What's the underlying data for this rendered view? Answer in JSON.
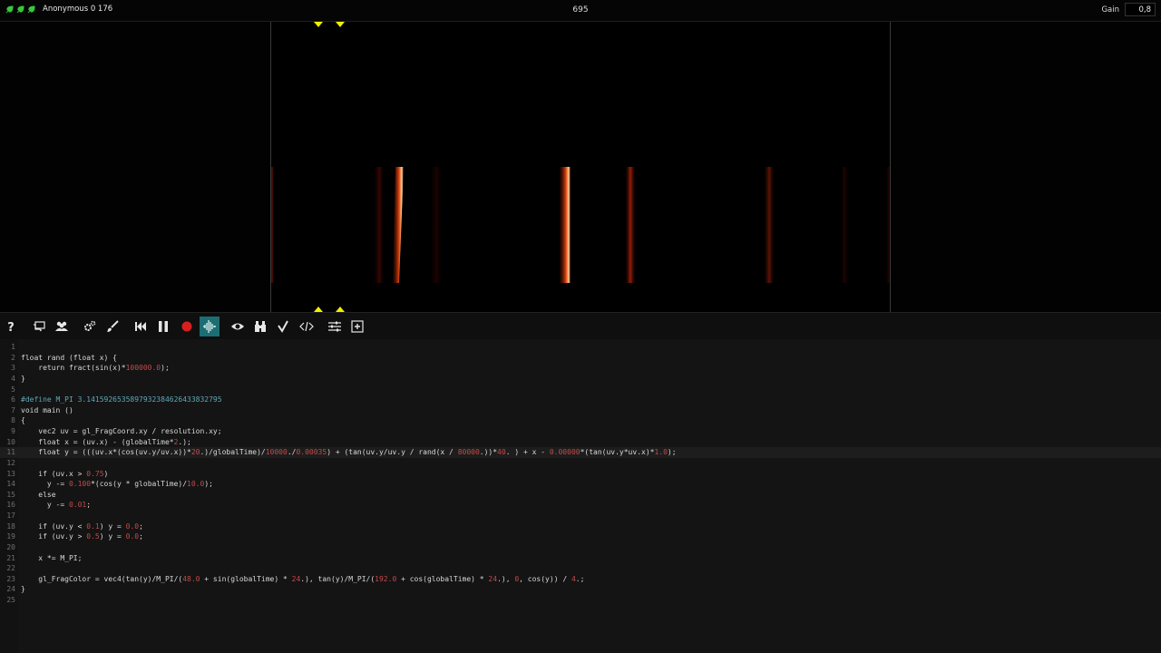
{
  "header": {
    "user_label": "Anonymous 0 176",
    "frame_counter": "695",
    "gain_label": "Gain",
    "gain_value": "0,8"
  },
  "toolbar": {
    "buttons": [
      {
        "name": "help-icon"
      },
      {
        "name": "chat-icon"
      },
      {
        "name": "users-icon"
      },
      {
        "name": "settings-icon"
      },
      {
        "name": "brush-icon"
      },
      {
        "name": "rewind-icon"
      },
      {
        "name": "pause-icon"
      },
      {
        "name": "record-icon"
      },
      {
        "name": "waveform-icon",
        "active": true
      },
      {
        "name": "eye-icon"
      },
      {
        "name": "binoculars-icon"
      },
      {
        "name": "check-icon"
      },
      {
        "name": "code-icon"
      },
      {
        "name": "sliders-icon"
      },
      {
        "name": "add-icon"
      }
    ]
  },
  "colors": {
    "accent": "#1b6e73",
    "marker": "#f0f000",
    "record": "#d62020"
  },
  "editor": {
    "active_line": 11,
    "lines": [
      {
        "n": "1",
        "t": ""
      },
      {
        "n": "2",
        "t": "float rand (float x) {"
      },
      {
        "n": "3",
        "t": "    return fract(sin(x)*100000.0);"
      },
      {
        "n": "4",
        "t": "}"
      },
      {
        "n": "5",
        "t": ""
      },
      {
        "n": "6",
        "t": "#define M_PI 3.1415926535897932384626433832795"
      },
      {
        "n": "7",
        "t": "void main ()"
      },
      {
        "n": "8",
        "t": "{"
      },
      {
        "n": "9",
        "t": "    vec2 uv = gl_FragCoord.xy / resolution.xy;"
      },
      {
        "n": "10",
        "t": "    float x = (uv.x) - (globalTime*2.);"
      },
      {
        "n": "11",
        "t": "    float y = (((uv.x*(cos(uv.y/uv.x))*20.)/globalTime)/10000./0.00035) + (tan(uv.y/uv.y / rand(x / 80000.))*40. ) + x - 0.00000*(tan(uv.y*uv.x)*1.0);"
      },
      {
        "n": "12",
        "t": ""
      },
      {
        "n": "13",
        "t": "    if (uv.x > 0.75)"
      },
      {
        "n": "14",
        "t": "      y -= 0.100*(cos(y * globalTime)/10.0);"
      },
      {
        "n": "15",
        "t": "    else"
      },
      {
        "n": "16",
        "t": "      y -= 0.01;"
      },
      {
        "n": "17",
        "t": ""
      },
      {
        "n": "18",
        "t": "    if (uv.y < 0.1) y = 0.0;"
      },
      {
        "n": "19",
        "t": "    if (uv.y > 0.5) y = 0.0;"
      },
      {
        "n": "20",
        "t": ""
      },
      {
        "n": "21",
        "t": "    x *= M_PI;"
      },
      {
        "n": "22",
        "t": ""
      },
      {
        "n": "23",
        "t": "    gl_FragColor = vec4(tan(y)/M_PI/(48.0 + sin(globalTime) * 24.), tan(y)/M_PI/(192.0 + cos(globalTime) * 24.), 0, cos(y)) / 4.;"
      },
      {
        "n": "24",
        "t": "}"
      },
      {
        "n": "25",
        "t": ""
      }
    ]
  }
}
